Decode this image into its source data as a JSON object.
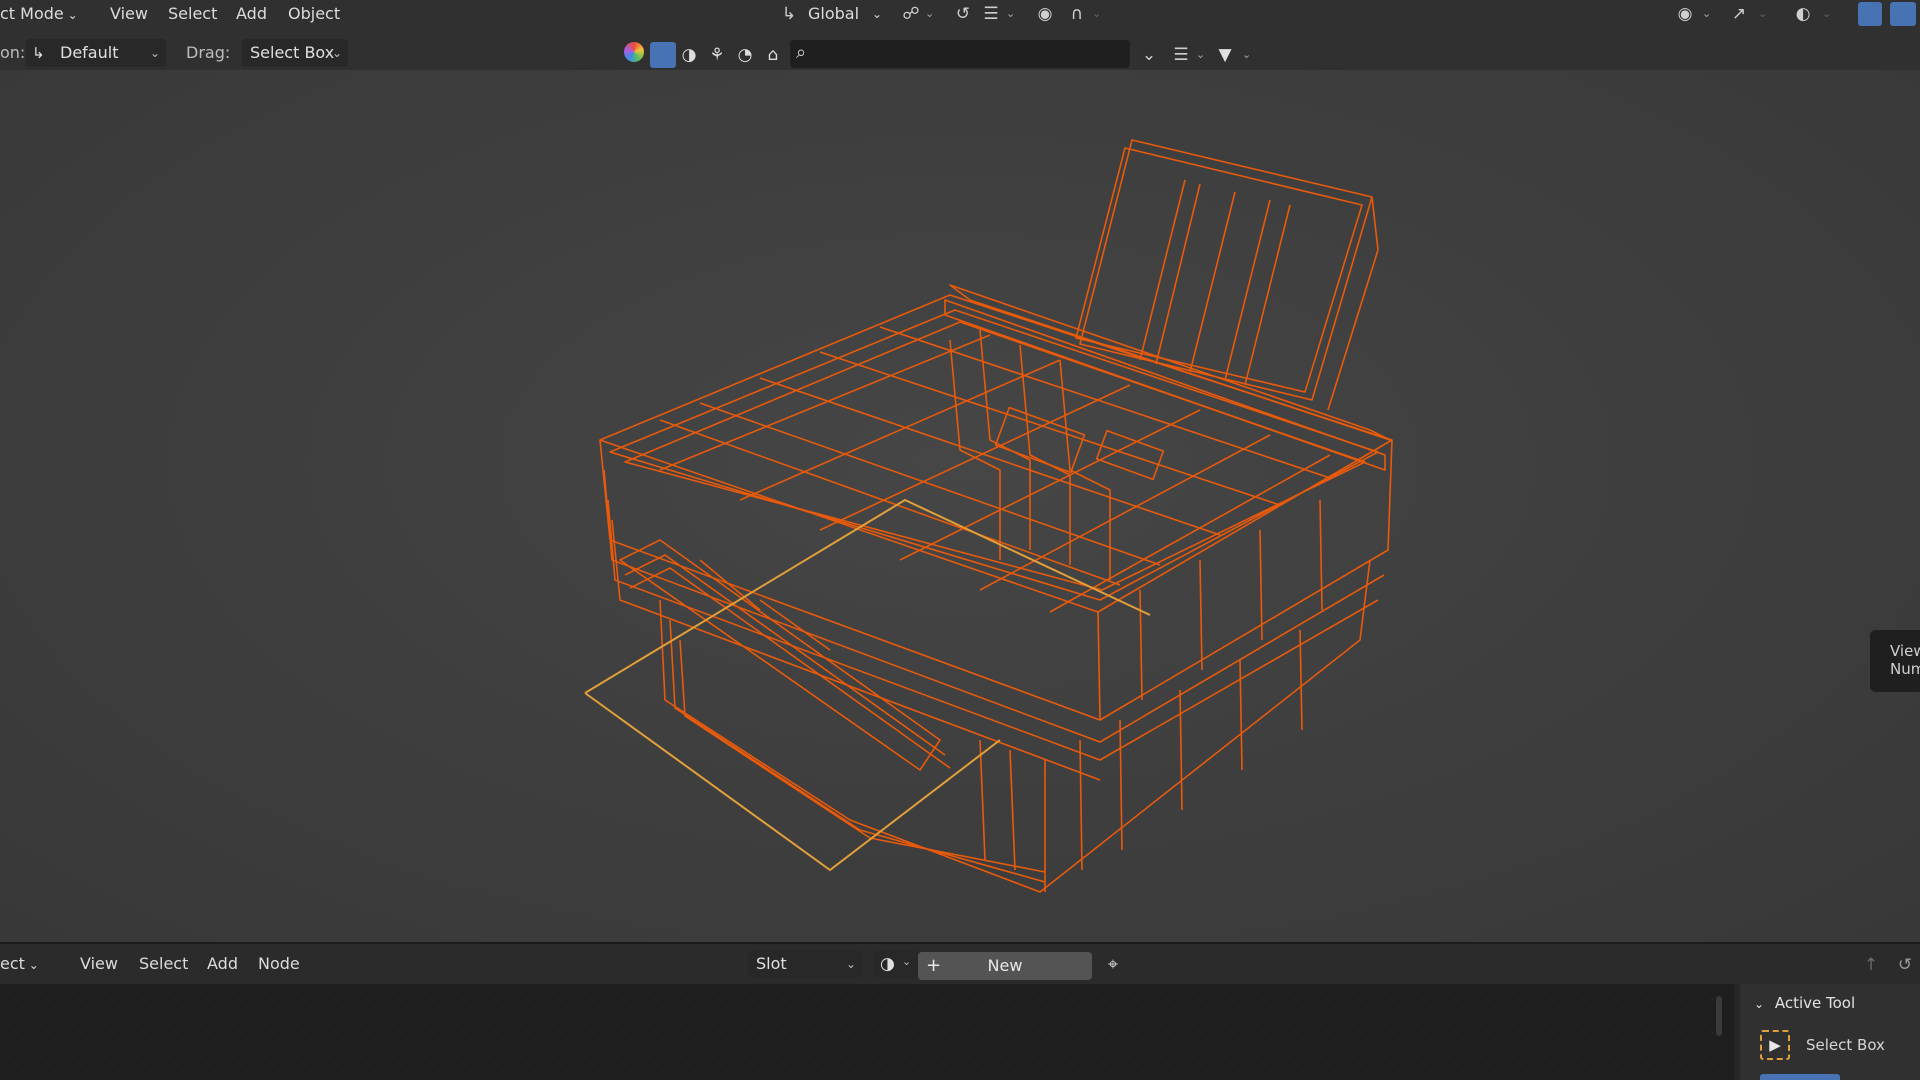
{
  "header": {
    "mode_label": "ct Mode",
    "menus": [
      "View",
      "Select",
      "Add",
      "Object"
    ],
    "transform_orientation": "Global"
  },
  "toolbar": {
    "orientation_prefix": "on:",
    "orientation_value": "Default",
    "drag_label": "Drag:",
    "drag_value": "Select Box",
    "search_placeholder": ""
  },
  "viewport": {
    "npanel_tab_line1": "View",
    "npanel_tab_line2": "Num",
    "wire_color": "#e85a0c",
    "selection_color": "#e3a03a"
  },
  "node_editor": {
    "mode_label": "ect",
    "menus": [
      "View",
      "Select",
      "Add",
      "Node"
    ],
    "slot_label": "Slot",
    "new_label": "New"
  },
  "active_tool": {
    "title": "Active Tool",
    "tool_name": "Select Box"
  }
}
